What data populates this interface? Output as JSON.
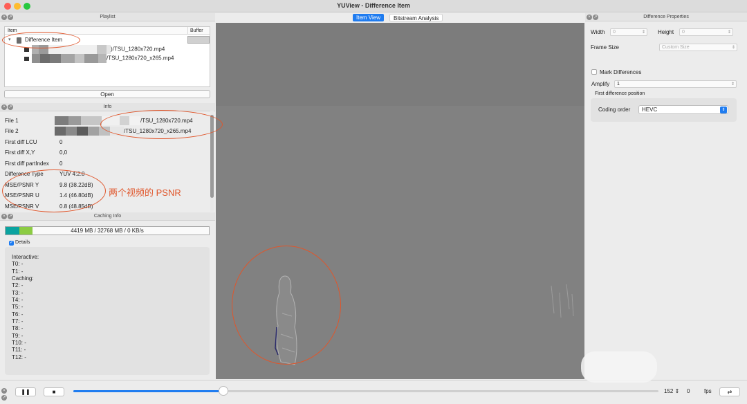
{
  "window": {
    "title": "YUView - Difference Item"
  },
  "playlist": {
    "title": "Playlist",
    "col_item": "Item",
    "col_buffer": "Buffer",
    "diff_item": "Difference Item",
    "file1": ")/TSU_1280x720.mp4",
    "file2": "/TSU_1280x720_x265.mp4",
    "open_label": "Open"
  },
  "info": {
    "title": "Info",
    "rows": [
      {
        "key": "File 1",
        "value": "/TSU_1280x720.mp4"
      },
      {
        "key": "File 2",
        "value": "/TSU_1280x720_x265.mp4"
      },
      {
        "key": "First diff LCU",
        "value": "0"
      },
      {
        "key": "First diff X,Y",
        "value": "0,0"
      },
      {
        "key": "First diff partIndex",
        "value": "0"
      },
      {
        "key": "Difference Type",
        "value": "YUV 4:2:0"
      },
      {
        "key": "MSE/PSNR Y",
        "value": "9.8 (38.22dB)"
      },
      {
        "key": "MSE/PSNR U",
        "value": "1.4 (46.80dB)"
      },
      {
        "key": "MSE/PSNR V",
        "value": "0.8 (48.85dB)"
      }
    ]
  },
  "annotation": {
    "psnr_note": "两个视频的 PSNR"
  },
  "caching": {
    "title": "Caching Info",
    "bar_text": "4419 MB / 32768 MB / 0 KB/s",
    "details_label": "Details",
    "details_lines": [
      "Interactive:",
      "T0: -",
      "T1: -",
      "Caching:",
      "T2: -",
      "T3: -",
      "T4: -",
      "T5: -",
      "T6: -",
      "T7: -",
      "T8: -",
      "T9: -",
      "T10: -",
      "T11: -",
      "T12: -"
    ]
  },
  "viewer": {
    "tab_item": "Item View",
    "tab_bitstream": "Bitstream Analysis"
  },
  "properties": {
    "title": "Difference Properties",
    "width_label": "Width",
    "width_value": "0",
    "height_label": "Height",
    "height_value": "0",
    "frame_size_label": "Frame Size",
    "frame_size_value": "Custom Size",
    "mark_label": "Mark Differences",
    "amplify_label": "Amplify",
    "amplify_value": "1",
    "first_diff_label": "First difference position",
    "coding_order_label": "Coding order",
    "coding_order_value": "HEVC"
  },
  "playback": {
    "pause_icon": "pause-icon",
    "stop_icon": "stop-icon",
    "frame": "152",
    "fps": "0",
    "fps_label": "fps",
    "repeat_icon": "repeat-icon",
    "slider_progress": 0.257
  },
  "colors": {
    "accent": "#1f7cf0",
    "annotation": "#e0562b",
    "cache_teal": "#0aa3a0",
    "cache_green": "#8ccc43"
  }
}
